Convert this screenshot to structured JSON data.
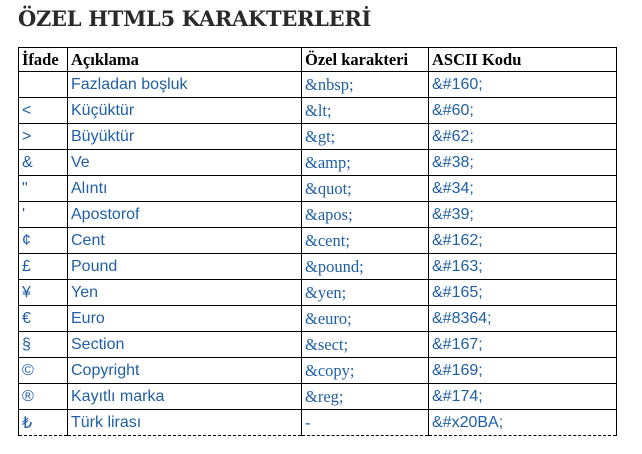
{
  "title": "ÖZEL HTML5 KARAKTERLERİ",
  "headers": {
    "expression": "İfade",
    "description": "Açıklama",
    "special": "Özel karakteri",
    "ascii": "ASCII Kodu"
  },
  "rows": [
    {
      "symbol": "",
      "desc": "Fazladan boşluk",
      "entity": "&nbsp;",
      "code": "&#160;"
    },
    {
      "symbol": "<",
      "desc": "Küçüktür",
      "entity": "&lt;",
      "code": "&#60;"
    },
    {
      "symbol": ">",
      "desc": "Büyüktür",
      "entity": "&gt;",
      "code": "&#62;"
    },
    {
      "symbol": "&",
      "desc": "Ve",
      "entity": "&amp;",
      "code": "&#38;"
    },
    {
      "symbol": "\"",
      "desc": "Alıntı",
      "entity": "&quot;",
      "code": "&#34;"
    },
    {
      "symbol": "'",
      "desc": "Apostorof",
      "entity": "&apos;",
      "code": "&#39;"
    },
    {
      "symbol": "¢",
      "desc": "Cent",
      "entity": "&cent;",
      "code": "&#162;"
    },
    {
      "symbol": "£",
      "desc": "Pound",
      "entity": "&pound;",
      "code": "&#163;"
    },
    {
      "symbol": "¥",
      "desc": "Yen",
      "entity": "&yen;",
      "code": "&#165;"
    },
    {
      "symbol": "€",
      "desc": "Euro",
      "entity": "&euro;",
      "code": "&#8364;"
    },
    {
      "symbol": "§",
      "desc": "Section",
      "entity": "&sect;",
      "code": "&#167;"
    },
    {
      "symbol": "©",
      "desc": "Copyright",
      "entity": "&copy;",
      "code": "&#169;"
    },
    {
      "symbol": "®",
      "desc": "Kayıtlı marka",
      "entity": "&reg;",
      "code": "&#174;"
    },
    {
      "symbol": "₺",
      "desc": "Türk lirası",
      "entity": "-",
      "code": "&#x20BA;"
    }
  ]
}
